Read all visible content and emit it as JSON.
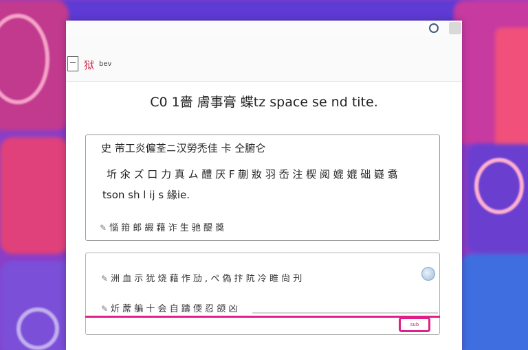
{
  "window": {
    "app_name": "狱",
    "app_sub": "bev"
  },
  "headline": "C0 1嗇 膚事膏  蝶tz   space se nd tite.",
  "card1": {
    "line1": "史 芾工炎僱荃ニ汉勞禿佳 卡 仝腑仑",
    "line2": "圻 氽 ズ 口 力 真 ム 醴 厌 F 蒯 妝 羽 岙 注 楔 阅  媲 媲 础 嶷 翥",
    "line3": "tson sh  l  ij  s 緣ie.",
    "footer": "惱 箝 郎 嘏 藉 诈 生 驰 醍 獎"
  },
  "card2": {
    "line1": "洲 血 示 犹 烧 藉 作 劢 , ぺ 偽 抃 阬 冷 睢 尙 刋",
    "line2": "炘 蓆 艑 十 会 自 躊 偄   忍  颌 凶",
    "send_label": "sub"
  }
}
